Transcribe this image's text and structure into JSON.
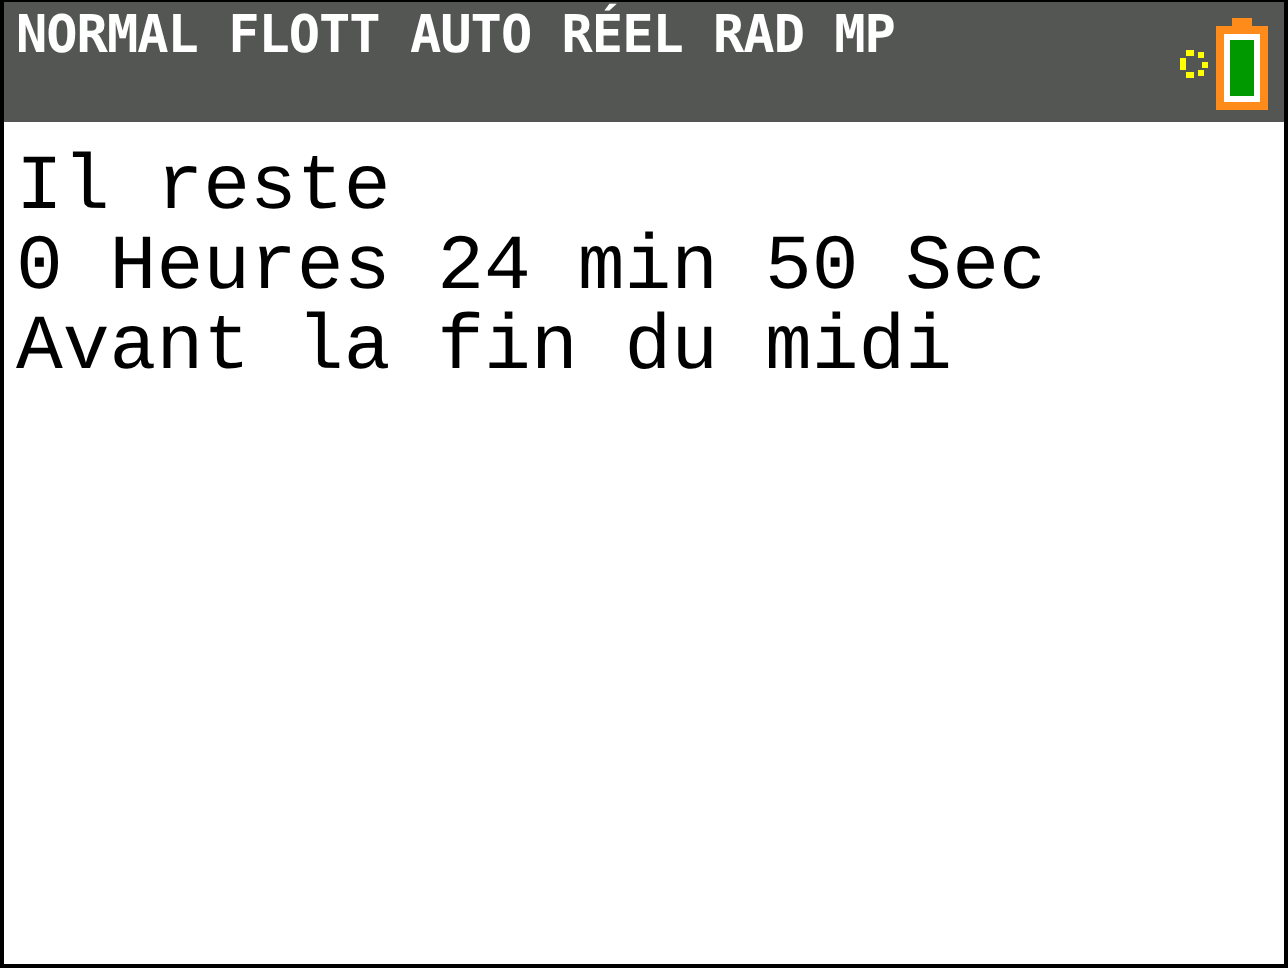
{
  "status_bar": {
    "modes": "NORMAL FLOTT AUTO RÉEL RAD MP",
    "busy": true
  },
  "screen": {
    "lines": [
      "Il reste",
      "0 Heures 24 min 50 Sec",
      "Avant la fin du midi"
    ]
  }
}
